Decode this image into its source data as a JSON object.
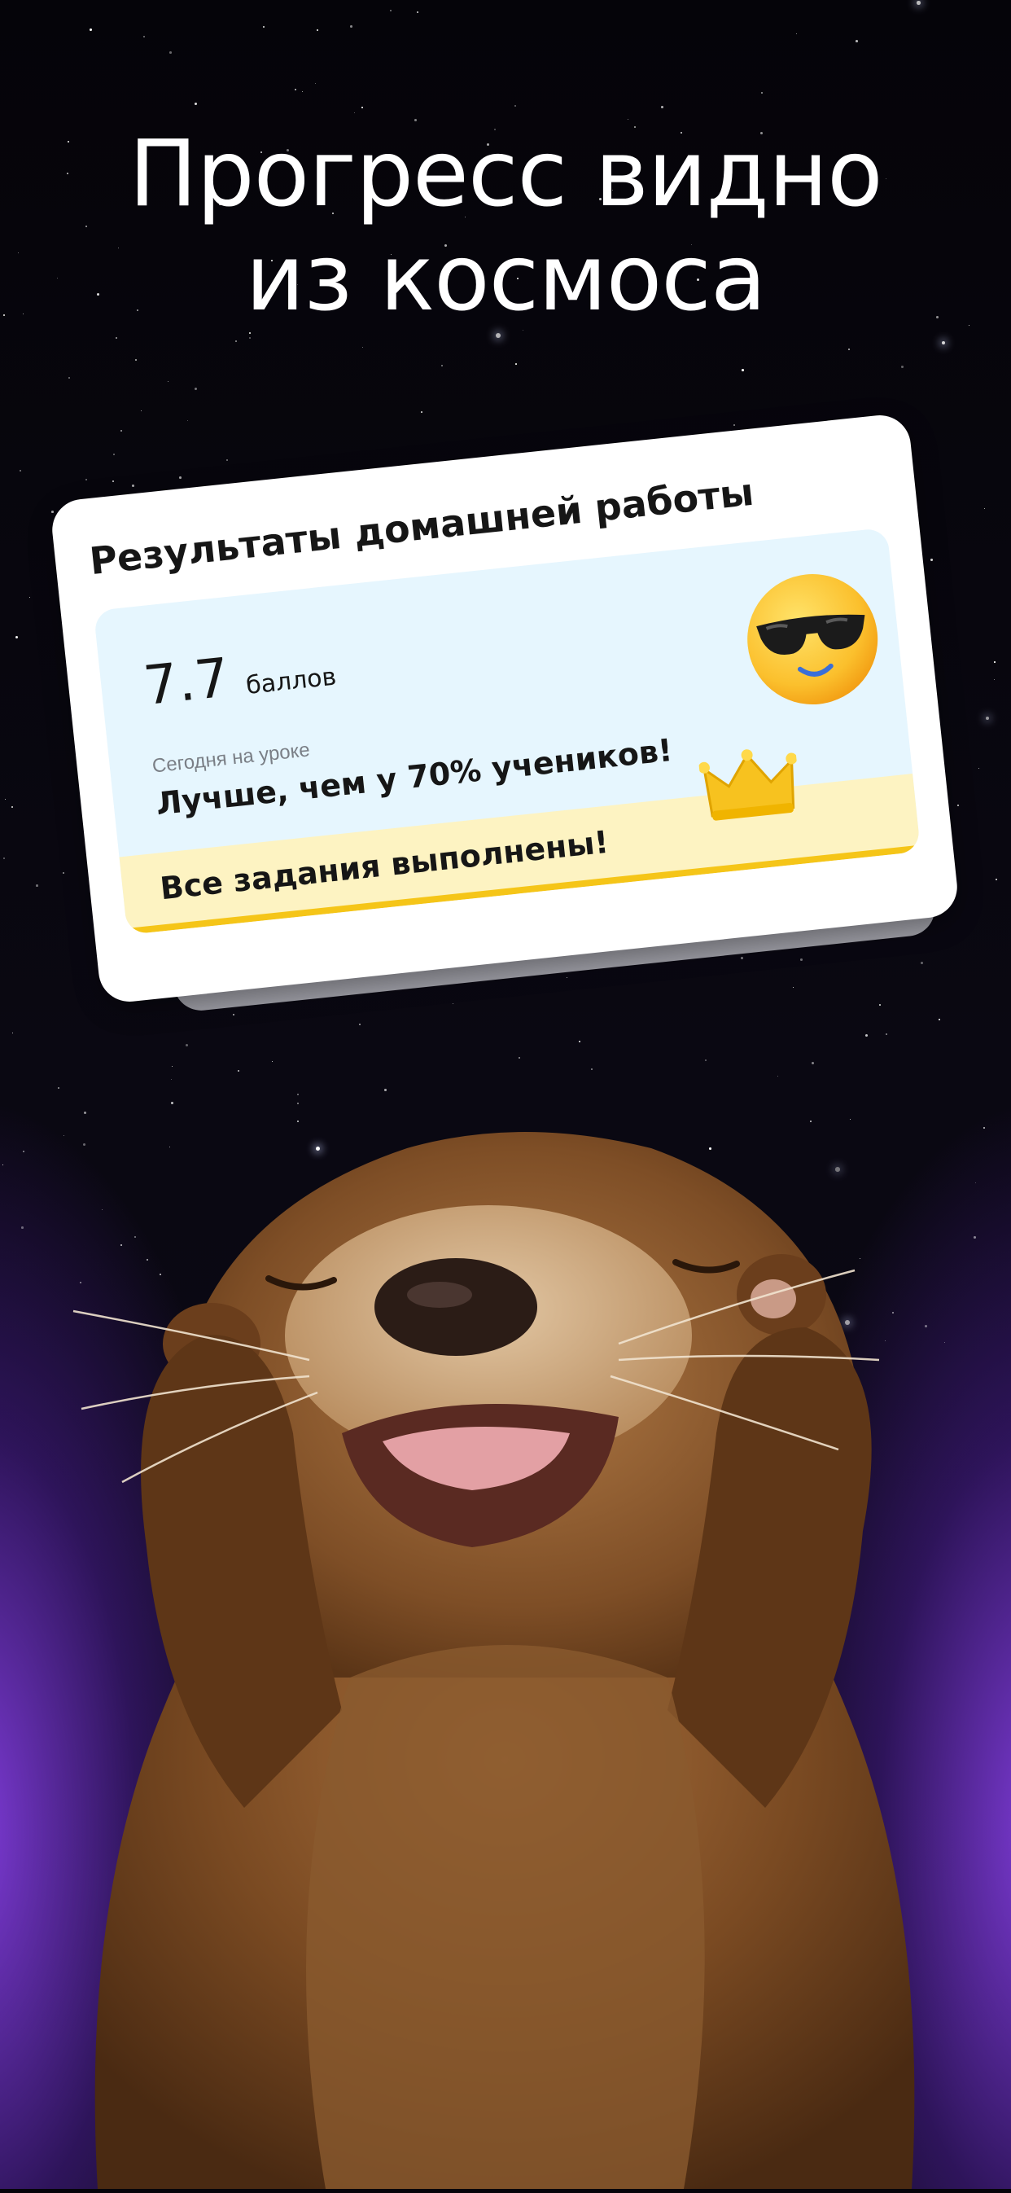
{
  "headline": {
    "line1": "Прогресс видно",
    "line2": "из космоса"
  },
  "result_card": {
    "title": "Результаты домашней работы",
    "score_value": "7.7",
    "score_unit": "баллов",
    "today_label": "Сегодня на уроке",
    "comparison_text": "Лучше, чем у 70% учеников!",
    "all_done_text": "Все задания выполнены!",
    "emoji_icon": "cool-sunglasses-emoji-icon",
    "badge_icon": "crown-icon"
  },
  "colors": {
    "background": "#05040a",
    "glow": "#9646ff",
    "card_inner": "#e6f6fe",
    "done_bar": "#fdf3c2",
    "done_bar_accent": "#f5c518",
    "text": "#161616"
  },
  "illustration": {
    "subject": "otter-photo"
  }
}
